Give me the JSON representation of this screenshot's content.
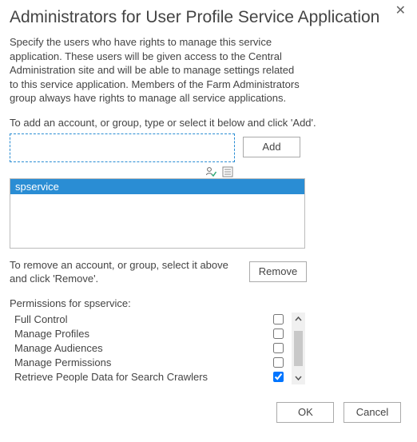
{
  "title": "Administrators for User Profile Service Application",
  "description": "Specify the users who have rights to manage this service application. These users will be given access to the Central Administration site and will be able to manage settings related to this service application. Members of the Farm Administrators group always have rights to manage all service applications.",
  "add_instruction": "To add an account, or group, type or select it below and click 'Add'.",
  "account_input": "",
  "buttons": {
    "add": "Add",
    "remove": "Remove",
    "ok": "OK",
    "cancel": "Cancel"
  },
  "list": {
    "items": [
      "spservice"
    ],
    "selected_index": 0
  },
  "remove_instruction": "To remove an account, or group, select it above and click 'Remove'.",
  "permissions_label": "Permissions for spservice:",
  "permissions": [
    {
      "name": "Full Control",
      "checked": false
    },
    {
      "name": "Manage Profiles",
      "checked": false
    },
    {
      "name": "Manage Audiences",
      "checked": false
    },
    {
      "name": "Manage Permissions",
      "checked": false
    },
    {
      "name": "Retrieve People Data for Search Crawlers",
      "checked": true
    }
  ],
  "close_glyph": "✕"
}
